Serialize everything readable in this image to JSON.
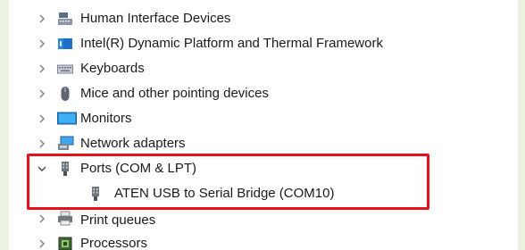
{
  "device_tree": {
    "items": [
      {
        "label": "Human Interface Devices",
        "icon": "human-interface-devices-icon",
        "expanded": false
      },
      {
        "label": "Intel(R) Dynamic Platform and Thermal Framework",
        "icon": "intel-dptf-icon",
        "expanded": false
      },
      {
        "label": "Keyboards",
        "icon": "keyboard-icon",
        "expanded": false
      },
      {
        "label": "Mice and other pointing devices",
        "icon": "mouse-icon",
        "expanded": false
      },
      {
        "label": "Monitors",
        "icon": "monitor-icon",
        "expanded": false
      },
      {
        "label": "Network adapters",
        "icon": "network-adapter-icon",
        "expanded": false
      },
      {
        "label": "Ports (COM & LPT)",
        "icon": "port-icon",
        "expanded": true,
        "children": [
          {
            "label": "ATEN USB to Serial Bridge (COM10)",
            "icon": "serial-port-icon"
          }
        ]
      },
      {
        "label": "Print queues",
        "icon": "printer-icon",
        "expanded": false
      },
      {
        "label": "Processors",
        "icon": "processor-icon",
        "expanded": false
      }
    ]
  },
  "highlight": {
    "color": "#e81019"
  }
}
